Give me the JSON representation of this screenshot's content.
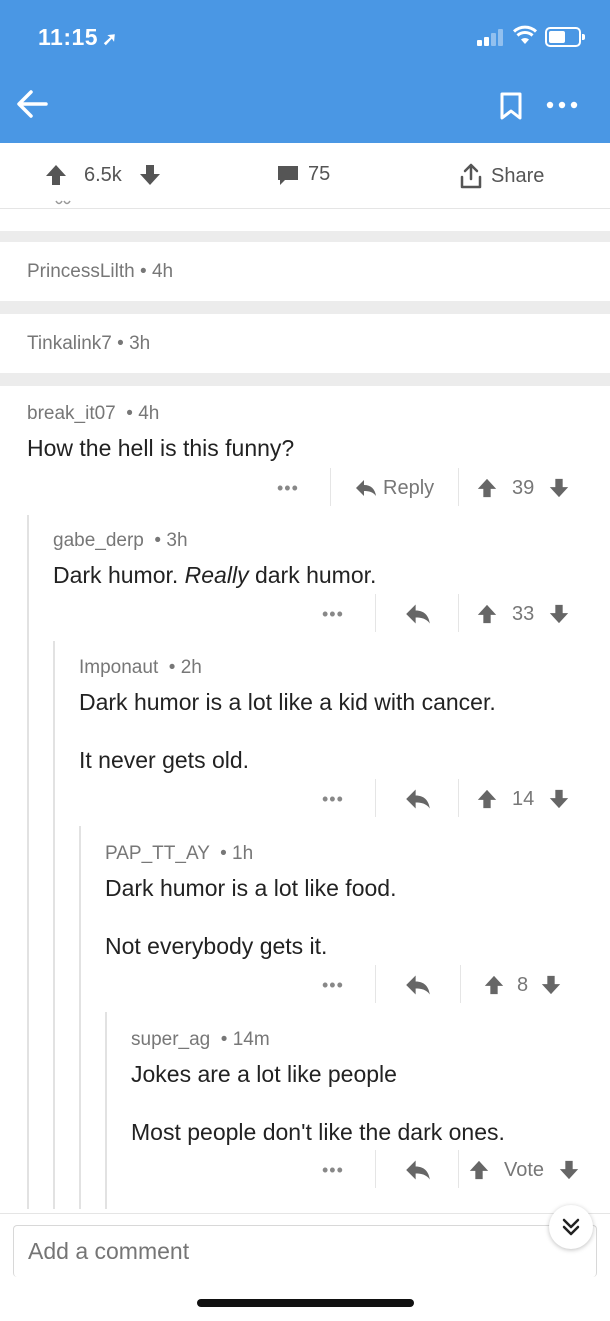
{
  "status_bar": {
    "time": "11:15"
  },
  "post_actions": {
    "upvotes": "6.5k",
    "comments": "75",
    "share": "Share"
  },
  "collapsed": [
    {
      "author": "PrincessLilth",
      "age": "4h"
    },
    {
      "author": "Tinkalink7",
      "age": "3h"
    }
  ],
  "comments": [
    {
      "author": "break_it07",
      "age": "4h",
      "lines": [
        "How the hell is this funny?"
      ],
      "reply": "Reply",
      "score": "39"
    },
    {
      "author": "gabe_derp",
      "age": "3h",
      "text_before": "Dark humor. ",
      "text_em": "Really",
      "text_after": " dark humor.",
      "score": "33"
    },
    {
      "author": "Imponaut",
      "age": "2h",
      "lines": [
        "Dark humor is a lot like a kid with cancer.",
        "It never gets old."
      ],
      "score": "14"
    },
    {
      "author": "PAP_TT_AY",
      "age": "1h",
      "lines": [
        "Dark humor is a lot like food.",
        "Not everybody gets it."
      ],
      "score": "8"
    },
    {
      "author": "super_ag",
      "age": "14m",
      "lines": [
        "Jokes are a lot like people",
        "Most people don't like the dark ones."
      ],
      "score": "Vote"
    }
  ],
  "composer": {
    "placeholder": "Add a comment"
  },
  "icons": {
    "back": "arrow-left-icon",
    "bookmark": "bookmark-icon",
    "more": "more-icon",
    "upvote": "arrow-up-icon",
    "downvote": "arrow-down-icon",
    "comment": "comment-icon",
    "share": "share-icon",
    "reply": "reply-icon",
    "scroll": "double-chevron-down-icon"
  },
  "colors": {
    "header": "#4a97e4",
    "icon": "#555555",
    "separator": "#ececec"
  }
}
